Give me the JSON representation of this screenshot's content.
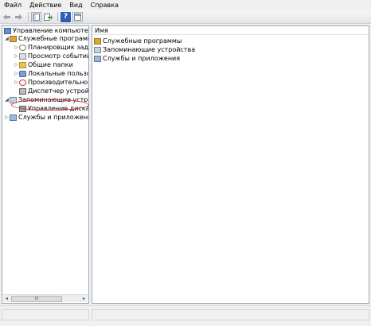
{
  "menu": [
    "Файл",
    "Действие",
    "Вид",
    "Справка"
  ],
  "toolbar": {
    "icons": [
      "back-arrow-icon",
      "forward-arrow-icon",
      "console-tree-icon",
      "export-icon",
      "help-icon",
      "panel-icon"
    ],
    "help_glyph": "?"
  },
  "tree": {
    "root": "Управление компьютером (л",
    "system_tools": "Служебные программы",
    "task_scheduler": "Планировщик заданий",
    "event_viewer": "Просмотр событий",
    "shared_folders": "Общие папки",
    "local_users": "Локальные пользовате",
    "performance": "Производительность",
    "device_manager": "Диспетчер устройств",
    "storage": "Запоминающие устройств",
    "disk_management": "Управление дисками",
    "services": "Службы и приложения",
    "expand_open": "◢",
    "expand_closed": "▷",
    "scroll_left": "◂",
    "scroll_right": "▸",
    "scroll_grip": "III"
  },
  "list": {
    "column_name": "Имя",
    "items": [
      "Служебные программы",
      "Запоминающие устройства",
      "Службы и приложения"
    ]
  },
  "colors": {
    "highlight_circle": "#d03030",
    "pane_border": "#9aa8b8"
  }
}
